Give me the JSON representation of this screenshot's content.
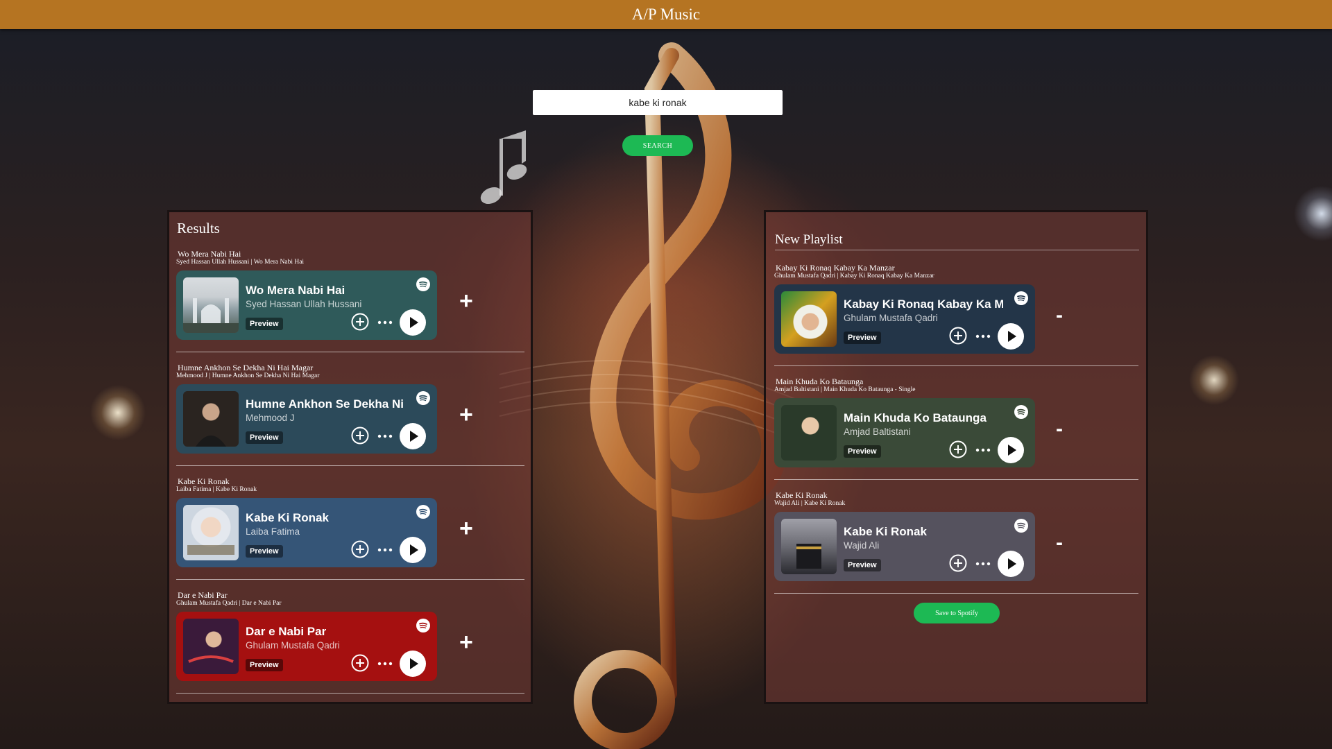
{
  "app": {
    "title": "A/P Music"
  },
  "search": {
    "value": "kabe ki ronak",
    "button_label": "SEARCH"
  },
  "results": {
    "heading": "Results",
    "items": [
      {
        "name": "Wo Mera Nabi Hai",
        "subtitle": "Syed Hassan Ullah Hussani | Wo Mera Nabi Hai",
        "card_title": "Wo Mera Nabi Hai",
        "card_artist": "Syed Hassan Ullah Hussani",
        "preview_label": "Preview",
        "action": "+",
        "card_color": "#2f5a5a"
      },
      {
        "name": "Humne Ankhon Se Dekha Ni Hai Magar",
        "subtitle": "Mehmood J | Humne Ankhon Se Dekha Ni Hai Magar",
        "card_title": "Humne Ankhon Se Dekha Ni",
        "card_artist": "Mehmood J",
        "preview_label": "Preview",
        "action": "+",
        "card_color": "#2c4a5a"
      },
      {
        "name": "Kabe Ki Ronak",
        "subtitle": "Laiba Fatima | Kabe Ki Ronak",
        "card_title": "Kabe Ki Ronak",
        "card_artist": "Laiba Fatima",
        "preview_label": "Preview",
        "action": "+",
        "card_color": "#355577"
      },
      {
        "name": "Dar e Nabi Par",
        "subtitle": "Ghulam Mustafa Qadri | Dar e Nabi Par",
        "card_title": "Dar e Nabi Par",
        "card_artist": "Ghulam Mustafa Qadri",
        "preview_label": "Preview",
        "action": "+",
        "card_color": "#a51010"
      }
    ]
  },
  "playlist": {
    "heading": "New Playlist",
    "items": [
      {
        "name": "Kabay Ki Ronaq Kabay Ka Manzar",
        "subtitle": "Ghulam Mustafa Qadri | Kabay Ki Ronaq Kabay Ka Manzar",
        "card_title": "Kabay Ki Ronaq Kabay Ka M",
        "card_artist": "Ghulam Mustafa Qadri",
        "preview_label": "Preview",
        "action": "-",
        "card_color": "#233548"
      },
      {
        "name": "Main Khuda Ko Bataunga",
        "subtitle": "Amjad Baltistani | Main Khuda Ko Bataunga - Single",
        "card_title": "Main Khuda Ko Bataunga",
        "card_artist": "Amjad Baltistani",
        "preview_label": "Preview",
        "action": "-",
        "card_color": "#3a4a38"
      },
      {
        "name": "Kabe Ki Ronak",
        "subtitle": "Wajid Ali | Kabe Ki Ronak",
        "card_title": "Kabe Ki Ronak",
        "card_artist": "Wajid Ali",
        "preview_label": "Preview",
        "action": "-",
        "card_color": "#55525e"
      }
    ],
    "save_label": "Save to Spotify"
  },
  "icons": {
    "service": "spotify-icon",
    "add": "add-circle-icon",
    "more": "more-icon",
    "play": "play-icon"
  }
}
